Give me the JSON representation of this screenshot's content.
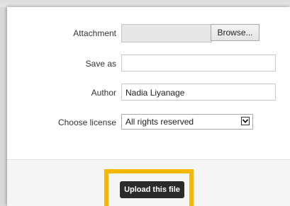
{
  "form": {
    "attachment": {
      "label": "Attachment",
      "browse_label": "Browse..."
    },
    "save_as": {
      "label": "Save as",
      "value": ""
    },
    "author": {
      "label": "Author",
      "value": "Nadia Liyanage"
    },
    "license": {
      "label": "Choose license",
      "selected": "All rights reserved"
    }
  },
  "footer": {
    "upload_label": "Upload this file"
  },
  "colors": {
    "highlight": "#f5b800",
    "upload_button": "#2b2b2b"
  },
  "icons": {
    "select_arrow": "chevron-down-icon"
  }
}
